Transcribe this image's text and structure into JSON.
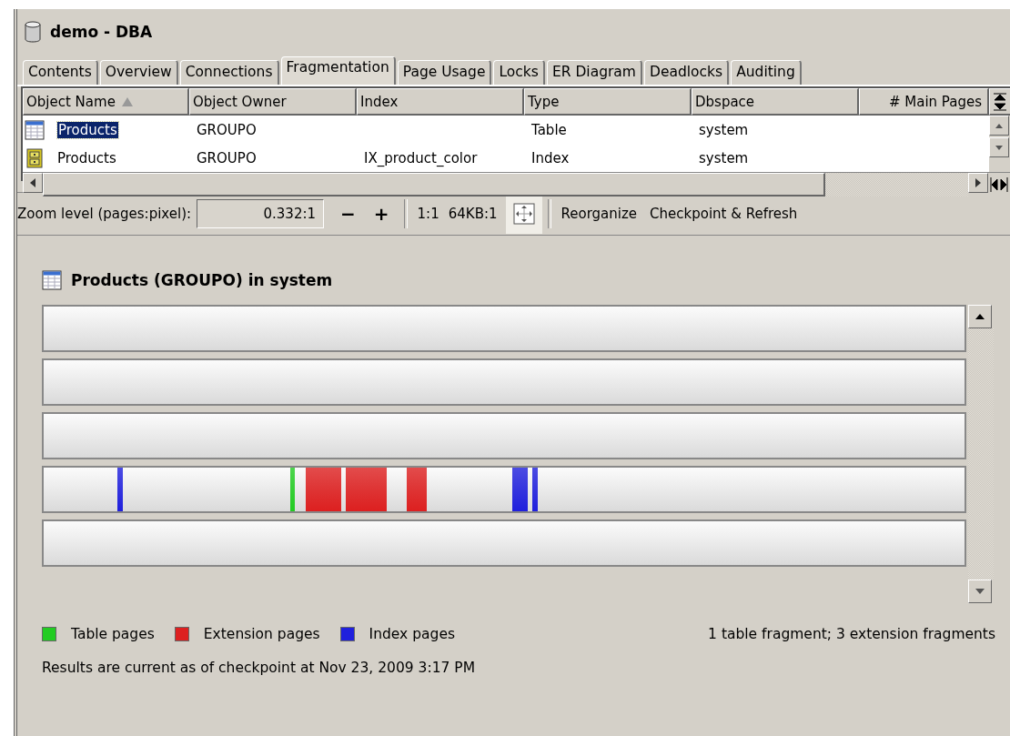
{
  "window": {
    "title": "demo - DBA"
  },
  "tabs": [
    {
      "label": "Contents",
      "selected": false
    },
    {
      "label": "Overview",
      "selected": false
    },
    {
      "label": "Connections",
      "selected": false
    },
    {
      "label": "Fragmentation",
      "selected": true
    },
    {
      "label": "Page Usage",
      "selected": false
    },
    {
      "label": "Locks",
      "selected": false
    },
    {
      "label": "ER Diagram",
      "selected": false
    },
    {
      "label": "Deadlocks",
      "selected": false
    },
    {
      "label": "Auditing",
      "selected": false
    }
  ],
  "table": {
    "columns": [
      {
        "label": "Object Name",
        "sorted": true
      },
      {
        "label": "Object Owner",
        "sorted": false
      },
      {
        "label": "Index",
        "sorted": false
      },
      {
        "label": "Type",
        "sorted": false
      },
      {
        "label": "Dbspace",
        "sorted": false
      },
      {
        "label": "# Main Pages",
        "sorted": false
      }
    ],
    "rows": [
      {
        "kind": "table",
        "selected": true,
        "object_name": "Products",
        "object_owner": "GROUPO",
        "type": "Table",
        "dbspace": "system"
      },
      {
        "kind": "index",
        "selected": false,
        "object_name": "Products",
        "object_owner": "GROUPO",
        "index": "IX_product_color",
        "type": "Index",
        "dbspace": "system"
      }
    ]
  },
  "toolbar": {
    "zoom_label": "Zoom level (pages:pixel):",
    "zoom_value": "0.332:1",
    "zoom_out": "−",
    "zoom_in": "+",
    "scale_buttons": [
      "1:1",
      "64KB:1"
    ],
    "actions": [
      "Reorganize",
      "Checkpoint & Refresh"
    ]
  },
  "map": {
    "title": "Products (GROUPO) in system"
  },
  "legend": [
    {
      "kind": "table",
      "label": "Table pages",
      "color": "#22cc22"
    },
    {
      "kind": "extension",
      "label": "Extension pages",
      "color": "#dd2020"
    },
    {
      "kind": "index",
      "label": "Index pages",
      "color": "#2020dd"
    }
  ],
  "summary": "1 table fragment; 3 extension fragments",
  "status": "Results are current as of checkpoint at Nov 23, 2009 3:17 PM"
}
